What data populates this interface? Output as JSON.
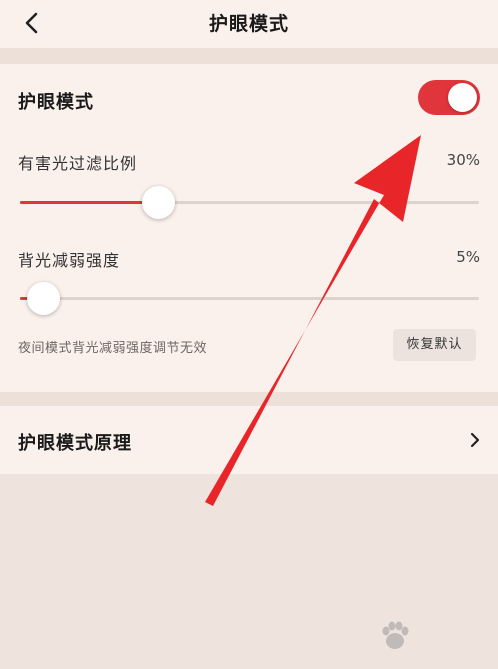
{
  "header": {
    "title": "护眼模式"
  },
  "settings": {
    "eye_mode": {
      "label": "护眼模式",
      "enabled": true,
      "accent_color": "#e0353b"
    },
    "filter": {
      "label": "有害光过滤比例",
      "value_text": "30%",
      "value": 0.3
    },
    "backlight": {
      "label": "背光减弱强度",
      "value_text": "5%",
      "value": 0.05
    },
    "note": "夜间模式背光减弱强度调节无效",
    "reset_label": "恢复默认"
  },
  "principle": {
    "label": "护眼模式原理",
    "icon": "chevron-right-icon"
  }
}
